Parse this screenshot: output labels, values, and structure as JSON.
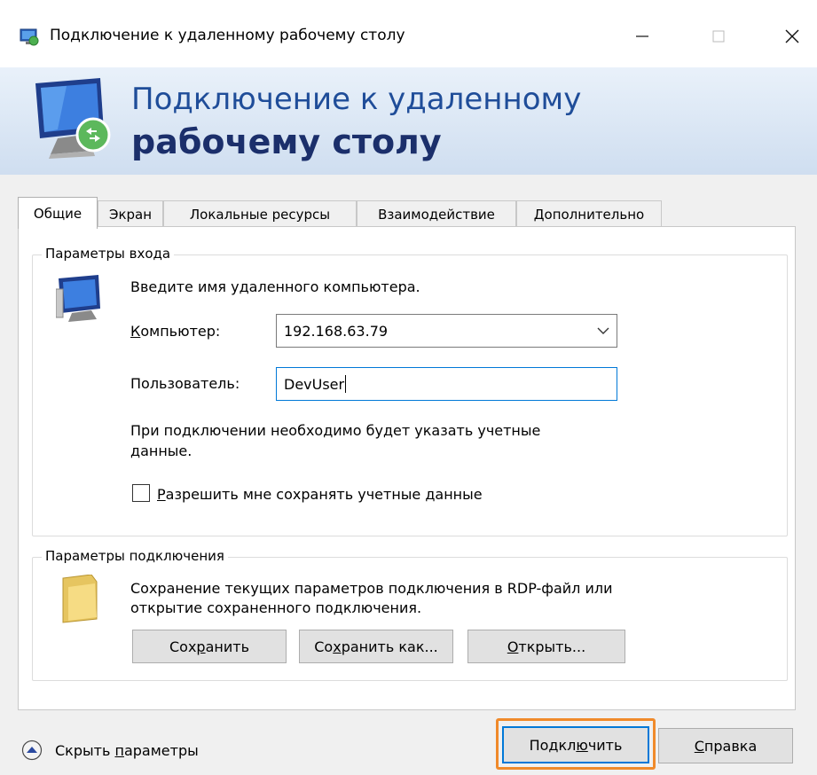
{
  "window": {
    "title": "Подключение к удаленному рабочему столу",
    "controls": {
      "minimize": "—",
      "maximize": "☐",
      "close": "✕"
    }
  },
  "banner": {
    "line1": "Подключение к удаленному",
    "line2": "рабочему столу"
  },
  "tabs": [
    {
      "label": "Общие",
      "active": true
    },
    {
      "label": "Экран",
      "active": false
    },
    {
      "label": "Локальные ресурсы",
      "active": false
    },
    {
      "label": "Взаимодействие",
      "active": false
    },
    {
      "label": "Дополнительно",
      "active": false
    }
  ],
  "login_group": {
    "label": "Параметры входа",
    "instruction": "Введите имя удаленного компьютера.",
    "computer_label": "Компьютер:",
    "computer_value": "192.168.63.79",
    "user_label": "Пользователь:",
    "user_value": "DevUser",
    "note_line1": "При подключении необходимо будет указать учетные",
    "note_line2": "данные.",
    "save_creds_label": "Разрешить мне сохранять учетные данные",
    "save_creds_checked": false
  },
  "connection_group": {
    "label": "Параметры подключения",
    "desc_line1": "Сохранение текущих параметров подключения в RDP-файл или",
    "desc_line2": "открытие сохраненного подключения.",
    "save_button": "Сохранить",
    "save_as_button": "Сохранить как...",
    "open_button": "Открыть..."
  },
  "footer": {
    "hide_options": "Скрыть параметры",
    "connect_button": "Подключить",
    "help_button": "Справка"
  },
  "colors": {
    "accent": "#0078d7",
    "highlight": "#f08a2a",
    "banner_text": "#1f4d99"
  }
}
